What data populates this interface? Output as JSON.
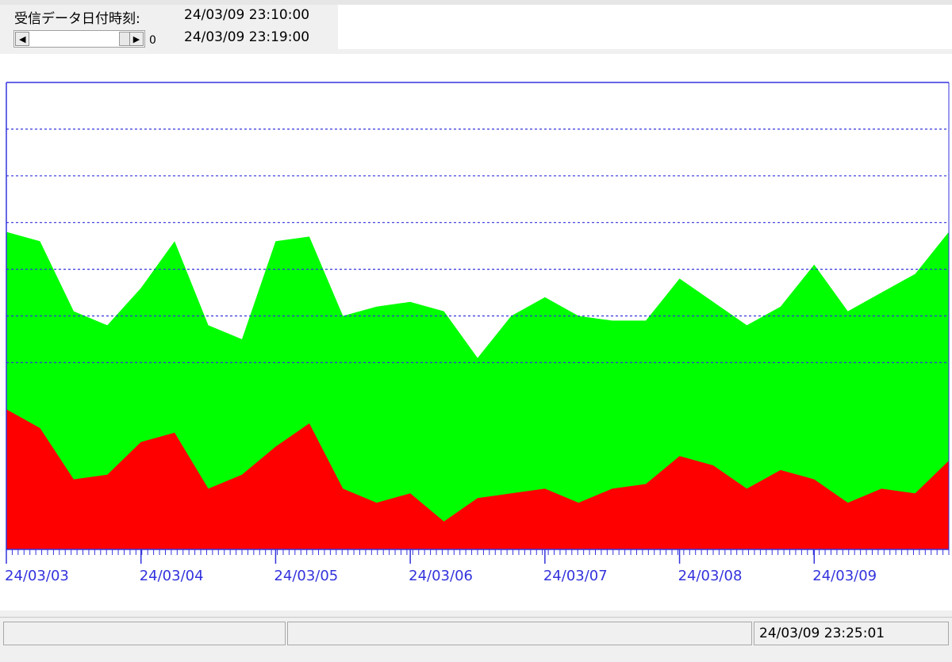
{
  "header": {
    "label": "受信データ日付時刻:",
    "time_start": "24/03/09 23:10:00",
    "time_end": "24/03/09 23:19:00",
    "scroll_value": "0"
  },
  "status_bar": {
    "datetime": "24/03/09 23:25:01"
  },
  "icons": {
    "scroll_left": "▶",
    "scroll_right": "▶"
  },
  "colors": {
    "upper_series": "#00ff00",
    "lower_series": "#ff0000",
    "axis": "#3333dd",
    "grid": "#3333dd"
  },
  "chart_data": {
    "type": "area",
    "stacked": true,
    "x": [
      "24/03/03",
      "24/03/03 06:00",
      "24/03/03 12:00",
      "24/03/03 18:00",
      "24/03/04",
      "24/03/04 06:00",
      "24/03/04 12:00",
      "24/03/04 18:00",
      "24/03/05",
      "24/03/05 06:00",
      "24/03/05 12:00",
      "24/03/05 18:00",
      "24/03/06",
      "24/03/06 06:00",
      "24/03/06 12:00",
      "24/03/06 18:00",
      "24/03/07",
      "24/03/07 06:00",
      "24/03/07 12:00",
      "24/03/07 18:00",
      "24/03/08",
      "24/03/08 06:00",
      "24/03/08 12:00",
      "24/03/08 18:00",
      "24/03/09",
      "24/03/09 06:00",
      "24/03/09 12:00",
      "24/03/09 18:00",
      "24/03/09 23:59"
    ],
    "x_tick_labels": [
      "24/03/03",
      "24/03/04",
      "24/03/05",
      "24/03/06",
      "24/03/07",
      "24/03/08",
      "24/03/09"
    ],
    "ylim": [
      0,
      10
    ],
    "grid_lines": [
      9,
      8,
      7,
      6,
      5,
      4
    ],
    "series": [
      {
        "values": [
          3.0,
          2.6,
          1.5,
          1.6,
          2.3,
          2.5,
          1.3,
          1.6,
          2.2,
          2.7,
          1.3,
          1.0,
          1.2,
          0.6,
          1.1,
          1.2,
          1.3,
          1.0,
          1.3,
          1.4,
          2.0,
          1.8,
          1.3,
          1.7,
          1.5,
          1.0,
          1.3,
          1.2,
          1.9
        ]
      },
      {
        "values": [
          3.8,
          4.0,
          3.6,
          3.2,
          3.3,
          4.1,
          3.5,
          2.9,
          4.4,
          4.0,
          3.7,
          4.2,
          4.1,
          4.5,
          3.0,
          3.8,
          4.1,
          4.0,
          3.6,
          3.5,
          3.8,
          3.5,
          3.5,
          3.5,
          4.6,
          4.1,
          4.2,
          4.7,
          4.9
        ]
      }
    ],
    "grid": true,
    "legend": "none"
  }
}
